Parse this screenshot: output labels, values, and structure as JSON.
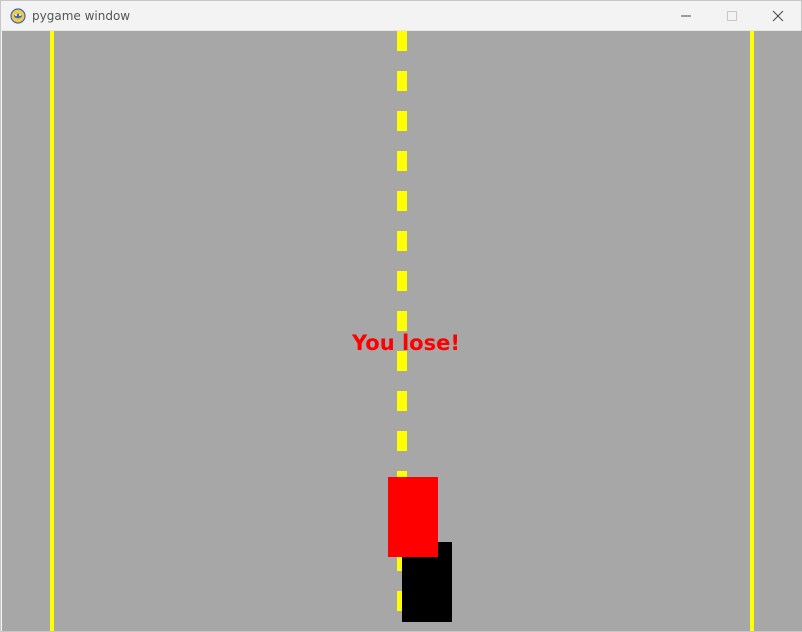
{
  "window": {
    "title": "pygame window",
    "app_icon": "pygame-snake-icon",
    "controls": {
      "minimize_icon": "minimize-icon",
      "maximize_icon": "maximize-icon",
      "close_icon": "close-icon"
    }
  },
  "game": {
    "message": "You lose!",
    "colors": {
      "road": "#a7a7a7",
      "lane_lines": "#ffff00",
      "message": "#ff0000",
      "player_car": "#ff0000",
      "enemy_car": "#000000"
    }
  }
}
